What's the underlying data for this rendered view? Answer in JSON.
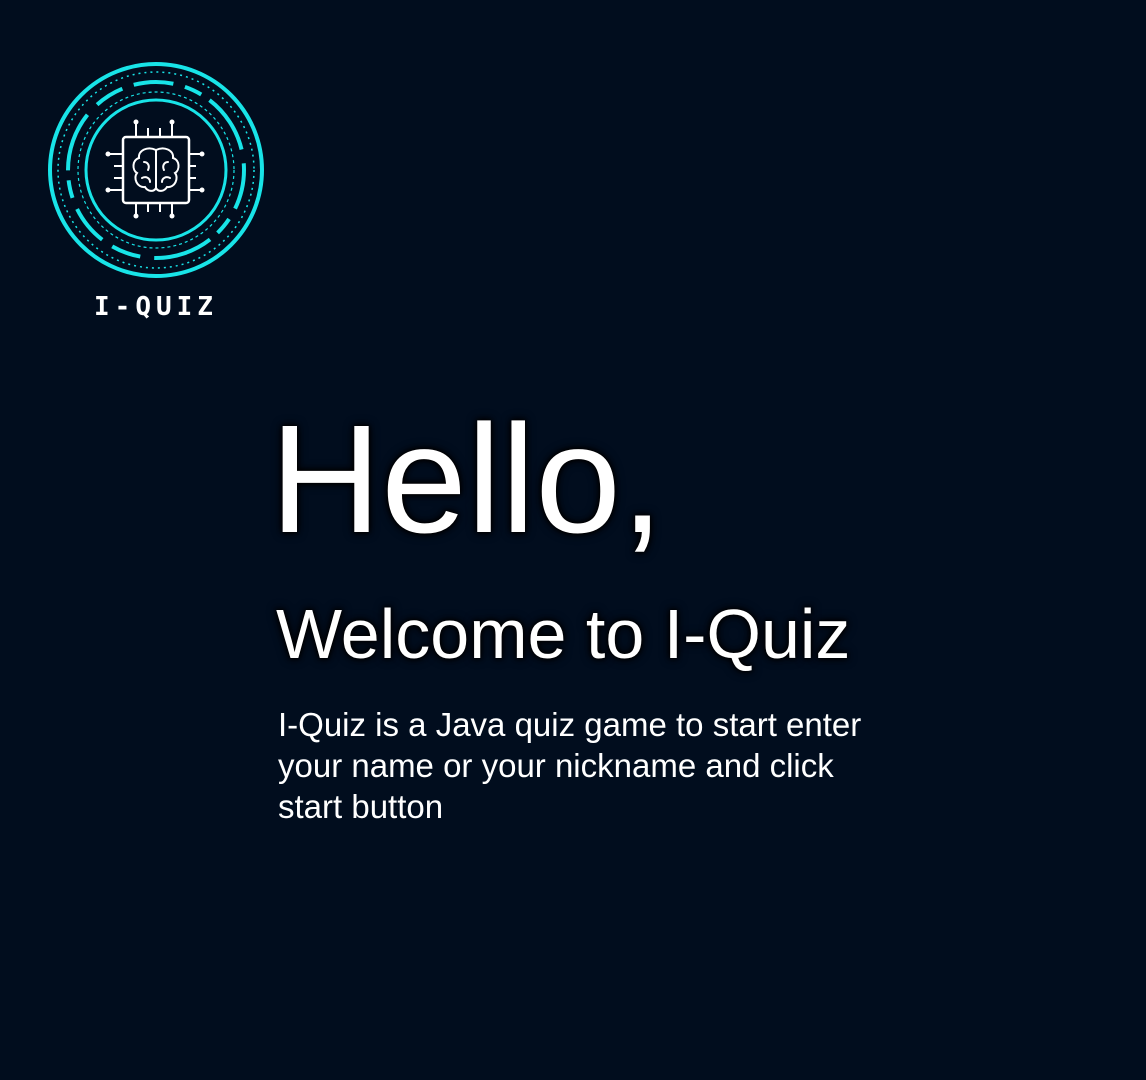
{
  "logo": {
    "icon": "brain-chip-icon",
    "brand_text": "I-QUIZ",
    "accent_color": "#18e4e8"
  },
  "main": {
    "greeting": "Hello,",
    "welcome": "Welcome to I-Quiz",
    "description": "I-Quiz is a Java quiz game to start enter your name or your nickname and click start button"
  },
  "colors": {
    "background": "#010d1e",
    "text": "#ffffff"
  }
}
